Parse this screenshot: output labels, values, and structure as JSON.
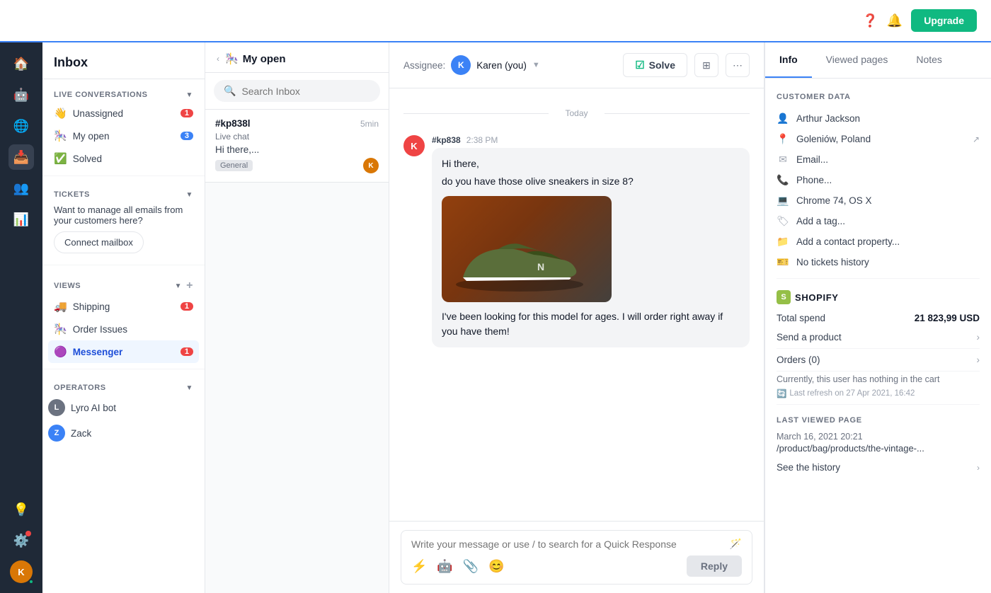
{
  "appBar": {
    "helpIcon": "?",
    "notifIcon": "🔔",
    "upgradeLabel": "Upgrade"
  },
  "rail": {
    "items": [
      {
        "icon": "🏠",
        "name": "home",
        "active": false
      },
      {
        "icon": "🤖",
        "name": "bot",
        "active": false
      },
      {
        "icon": "🌐",
        "name": "network",
        "active": false
      },
      {
        "icon": "📥",
        "name": "inbox",
        "active": true
      },
      {
        "icon": "👥",
        "name": "contacts",
        "active": false
      },
      {
        "icon": "📊",
        "name": "reports",
        "active": false
      }
    ],
    "bottomItems": [
      {
        "icon": "💡",
        "name": "tips",
        "hasBadge": false
      },
      {
        "icon": "⚙️",
        "name": "settings",
        "hasBadge": true
      },
      {
        "icon": "🟢",
        "name": "avatar",
        "hasBadge": false
      }
    ]
  },
  "sidebar": {
    "title": "Inbox",
    "liveConversations": {
      "label": "LIVE CONVERSATIONS",
      "items": [
        {
          "icon": "👋",
          "label": "Unassigned",
          "badge": 1,
          "badgeColor": "red"
        },
        {
          "icon": "🎠",
          "label": "My open",
          "badge": 3,
          "badgeColor": "blue"
        },
        {
          "icon": "✅",
          "label": "Solved",
          "badge": null
        }
      ]
    },
    "tickets": {
      "label": "TICKETS",
      "noTicketsText": "Want to manage all emails from your customers here?",
      "connectLabel": "Connect mailbox"
    },
    "views": {
      "label": "VIEWS",
      "items": [
        {
          "icon": "🚚",
          "label": "Shipping",
          "badge": 1
        },
        {
          "icon": "🎠",
          "label": "Order Issues",
          "badge": null
        },
        {
          "icon": "🟣",
          "label": "Messenger",
          "badge": 1
        }
      ]
    },
    "operators": {
      "label": "OPERATORS",
      "items": [
        {
          "initials": "L",
          "color": "#6b7280",
          "label": "Lyro AI bot"
        },
        {
          "initials": "Z",
          "color": "#3b82f6",
          "label": "Zack"
        }
      ]
    }
  },
  "convList": {
    "title": "My open",
    "titleIcon": "🎠",
    "searchPlaceholder": "Search Inbox",
    "conversations": [
      {
        "id": "#kp838l",
        "channel": "Live chat",
        "time": "5min",
        "preview": "Hi there,...",
        "tag": "General",
        "avatarInitials": "K",
        "avatarColor": "#d97706"
      }
    ]
  },
  "chat": {
    "assigneeLabel": "Assignee:",
    "assigneeName": "Karen (you)",
    "assigneeInitials": "K",
    "solveLabel": "Solve",
    "daySeparator": "Today",
    "message": {
      "id": "#kp838",
      "time": "2:38 PM",
      "avatarInitials": "K",
      "avatarColor": "#ef4444",
      "lines": [
        "Hi there,",
        "do you have those olive sneakers in size 8?",
        "I've been looking for this model for ages. I will order right away if you have them!"
      ]
    },
    "inputPlaceholder": "Write your message or use / to search for a Quick Response",
    "replyLabel": "Reply"
  },
  "rightPanel": {
    "tabs": [
      "Info",
      "Viewed pages",
      "Notes"
    ],
    "activeTab": "Info",
    "customerData": {
      "sectionLabel": "CUSTOMER DATA",
      "name": "Arthur Jackson",
      "location": "Goleniów, Poland",
      "emailPlaceholder": "Email...",
      "phonePlaceholder": "Phone...",
      "browser": "Chrome 74, OS X",
      "tagPlaceholder": "Add a tag...",
      "propertyPlaceholder": "Add a contact property...",
      "noTickets": "No tickets history"
    },
    "shopify": {
      "sectionLabel": "SHOPIFY",
      "totalSpendLabel": "Total spend",
      "totalSpendAmount": "21 823,99 USD",
      "sendProductLabel": "Send a product",
      "ordersLabel": "Orders (0)",
      "cartNote": "Currently, this user has nothing in the cart",
      "lastRefresh": "Last refresh on 27 Apr 2021, 16:42"
    },
    "lastViewedPage": {
      "sectionLabel": "LAST VIEWED PAGE",
      "date": "March 16, 2021 20:21",
      "url": "/product/bag/products/the-vintage-...",
      "historyLabel": "See the history"
    }
  }
}
